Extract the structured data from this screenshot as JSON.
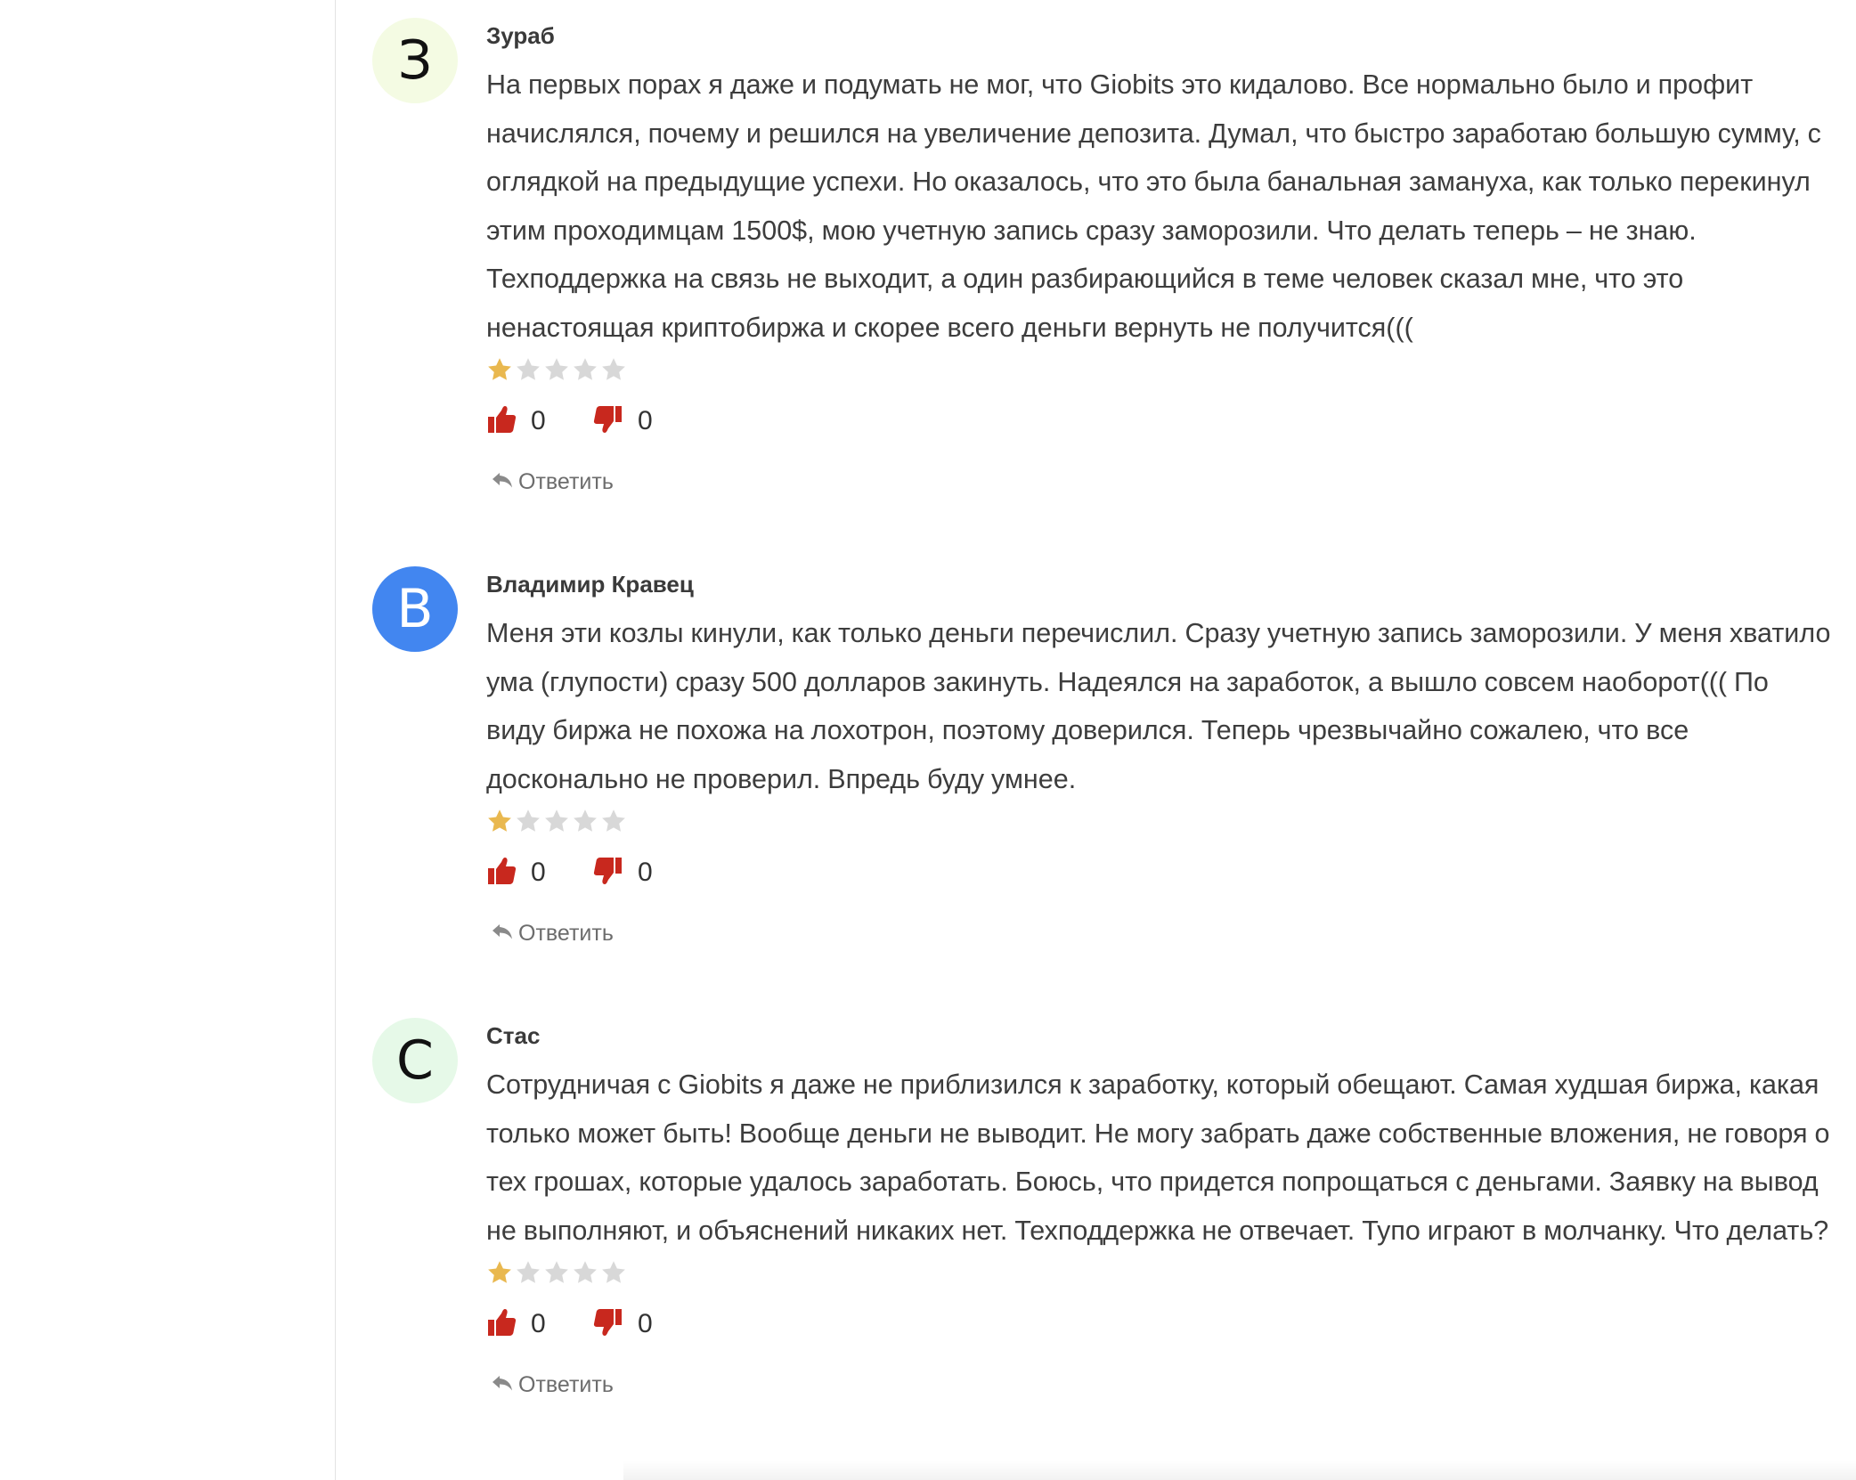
{
  "comments": [
    {
      "avatar_letter": "З",
      "avatar_bg": "#f4fbe3",
      "avatar_color": "#111111",
      "author": "Зураб",
      "text": "На первых порах я даже и подумать не мог, что Giobits это кидалово. Все нормально было и профит начислялся, почему и решился на увеличение депозита. Думал, что быстро заработаю большую сумму, с оглядкой на предыдущие успехи. Но оказалось, что это была банальная замануха, как только перекинул этим проходимцам 1500$, мою учетную запись сразу заморозили. Что делать теперь – не знаю. Техподдержка на связь не выходит, а один разбирающийся в теме человек сказал мне, что это ненастоящая криптобиржа и скорее всего деньги вернуть не получится(((",
      "rating": 1,
      "rating_max": 5,
      "likes": "0",
      "dislikes": "0",
      "reply_label": "Ответить"
    },
    {
      "avatar_letter": "В",
      "avatar_bg": "#4286f0",
      "avatar_color": "#ffffff",
      "author": "Владимир Кравец",
      "text": "Меня эти козлы кинули, как только деньги перечислил. Сразу учетную запись заморозили. У меня хватило ума (глупости) сразу 500 долларов закинуть. Надеялся на заработок, а вышло совсем наоборот((( По виду биржа не похожа на лохотрон, поэтому доверился. Теперь чрезвычайно сожалею, что все досконально не проверил. Впредь буду умнее.",
      "rating": 1,
      "rating_max": 5,
      "likes": "0",
      "dislikes": "0",
      "reply_label": "Ответить"
    },
    {
      "avatar_letter": "С",
      "avatar_bg": "#e6f9e8",
      "avatar_color": "#111111",
      "author": "Стас",
      "text": "Сотрудничая с Giobits я даже не приблизился к заработку, который обещают. Самая худшая биржа, какая только может быть! Вообще деньги не выводит. Не могу забрать даже собственные вложения, не говоря о тех грошах, которые удалось заработать. Боюсь, что придется попрощаться с деньгами. Заявку на вывод не выполняют, и объяснений никаких нет. Техподдержка не отвечает. Тупо играют в молчанку. Что делать?",
      "rating": 1,
      "rating_max": 5,
      "likes": "0",
      "dislikes": "0",
      "reply_label": "Ответить"
    }
  ],
  "colors": {
    "star_filled": "#e9b84f",
    "star_empty": "#d8d8d8",
    "thumb": "#c8281e",
    "reply_icon": "#8a8a8a"
  },
  "icons": {
    "like": "thumbs-up-icon",
    "dislike": "thumbs-down-icon",
    "reply": "reply-arrow-icon",
    "star": "star-icon"
  }
}
